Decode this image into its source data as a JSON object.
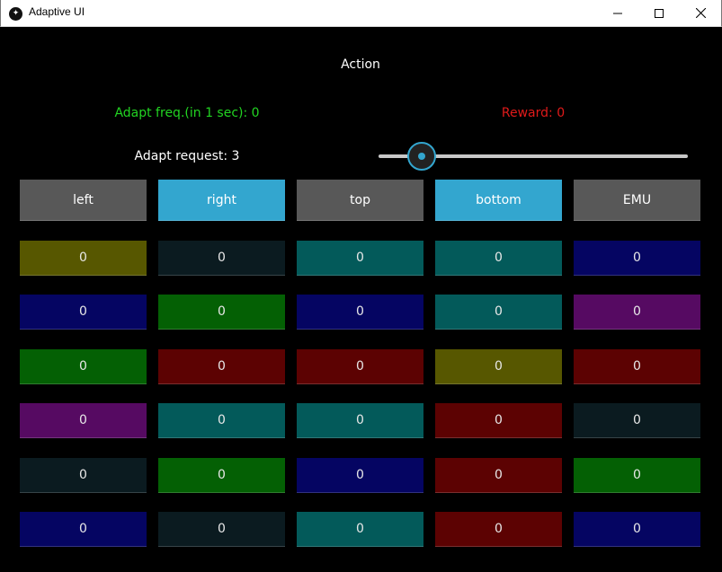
{
  "window": {
    "title": "Adaptive UI",
    "minimize_icon": "minimize-icon",
    "maximize_icon": "maximize-icon",
    "close_icon": "close-icon"
  },
  "header": {
    "action": "Action",
    "adapt_freq": "Adapt freq.(in 1 sec): 0",
    "reward": "Reward: 0",
    "adapt_request": "Adapt request: 3"
  },
  "slider": {
    "value_fraction": 0.14,
    "accent": "#33a6cf"
  },
  "colors": {
    "adapt_freq": "#22d422",
    "reward": "#e01a1a",
    "button_default": "#585858",
    "button_active": "#33a6cf",
    "olive": "#575700",
    "dark": "#0b1b20",
    "teal": "#035a5a",
    "navy": "#050562",
    "green": "#046004",
    "purple": "#560a62",
    "maroon": "#5c0202"
  },
  "buttons": [
    {
      "label": "left",
      "active": false
    },
    {
      "label": "right",
      "active": true
    },
    {
      "label": "top",
      "active": false
    },
    {
      "label": "bottom",
      "active": true
    },
    {
      "label": "EMU",
      "active": false
    }
  ],
  "grid": [
    [
      {
        "value": "0",
        "color": "olive"
      },
      {
        "value": "0",
        "color": "dark"
      },
      {
        "value": "0",
        "color": "teal"
      },
      {
        "value": "0",
        "color": "teal"
      },
      {
        "value": "0",
        "color": "navy"
      }
    ],
    [
      {
        "value": "0",
        "color": "navy"
      },
      {
        "value": "0",
        "color": "green"
      },
      {
        "value": "0",
        "color": "navy"
      },
      {
        "value": "0",
        "color": "teal"
      },
      {
        "value": "0",
        "color": "purple"
      }
    ],
    [
      {
        "value": "0",
        "color": "green"
      },
      {
        "value": "0",
        "color": "maroon"
      },
      {
        "value": "0",
        "color": "maroon"
      },
      {
        "value": "0",
        "color": "olive"
      },
      {
        "value": "0",
        "color": "maroon"
      }
    ],
    [
      {
        "value": "0",
        "color": "purple"
      },
      {
        "value": "0",
        "color": "teal"
      },
      {
        "value": "0",
        "color": "teal"
      },
      {
        "value": "0",
        "color": "maroon"
      },
      {
        "value": "0",
        "color": "dark"
      }
    ],
    [
      {
        "value": "0",
        "color": "dark"
      },
      {
        "value": "0",
        "color": "green"
      },
      {
        "value": "0",
        "color": "navy"
      },
      {
        "value": "0",
        "color": "maroon"
      },
      {
        "value": "0",
        "color": "green"
      }
    ],
    [
      {
        "value": "0",
        "color": "navy"
      },
      {
        "value": "0",
        "color": "dark"
      },
      {
        "value": "0",
        "color": "teal"
      },
      {
        "value": "0",
        "color": "maroon"
      },
      {
        "value": "0",
        "color": "navy"
      }
    ]
  ]
}
